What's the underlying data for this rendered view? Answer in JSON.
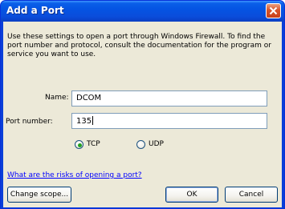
{
  "window": {
    "title": "Add a Port"
  },
  "description": "Use these settings to open a port through Windows Firewall. To find the port number and protocol, consult the documentation for the program or service you want to use.",
  "form": {
    "name_label": "Name:",
    "name_value": "DCOM",
    "port_label": "Port number:",
    "port_value": "135"
  },
  "protocol": {
    "options": [
      "TCP",
      "UDP"
    ],
    "selected": "TCP"
  },
  "link_text": "What are the risks of opening a port?",
  "buttons": {
    "change_scope": "Change scope...",
    "ok": "OK",
    "cancel": "Cancel"
  },
  "colors": {
    "titlebar": "#0554e3",
    "dialog_bg": "#ece9d8",
    "close_button": "#d8542a",
    "link": "#0000ff",
    "radio_selected": "#21a121"
  },
  "icons": {
    "close": "close-icon"
  }
}
